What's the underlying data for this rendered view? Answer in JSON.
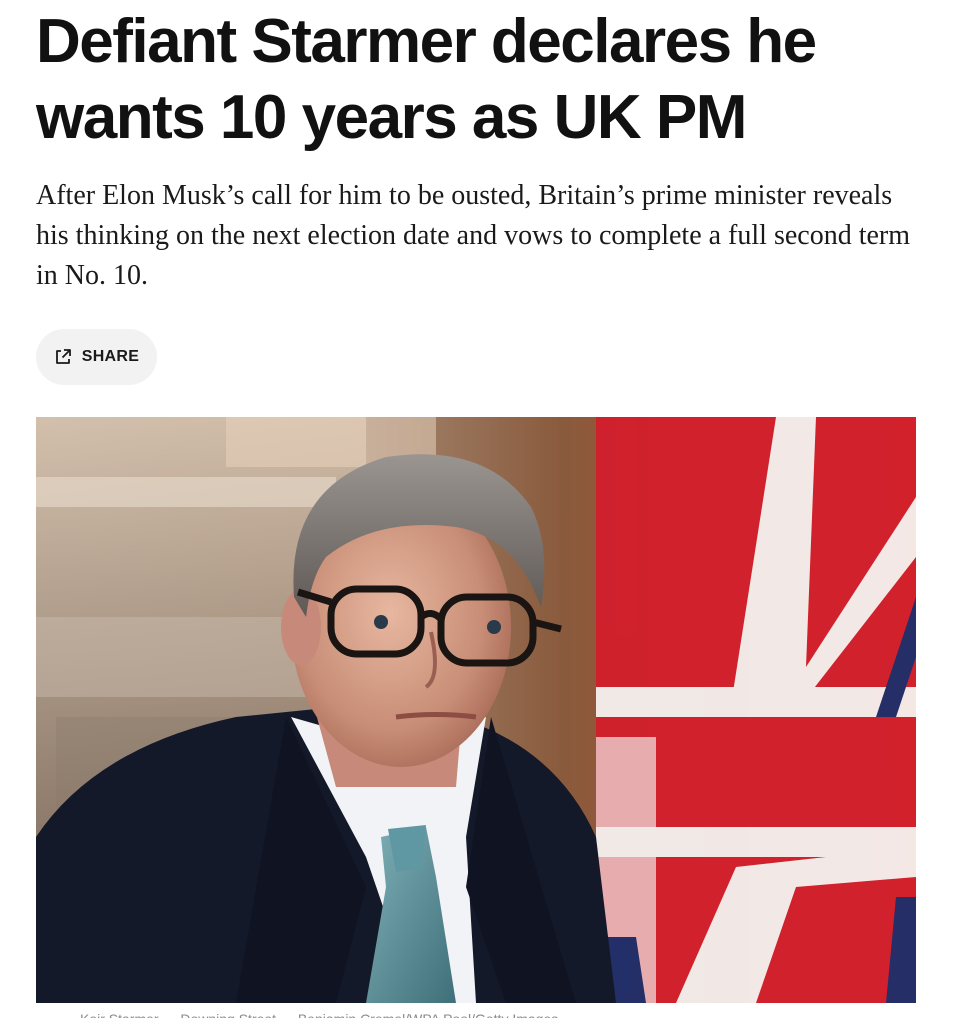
{
  "article": {
    "headline": "Defiant Starmer declares he wants 10 years as UK PM",
    "dek": "After Elon Musk’s call for him to be ousted, Britain’s prime minister reveals his thinking on the next election date and vows to complete a full second term in No. 10.",
    "share": {
      "label": "SHARE",
      "icon": "share-external-icon"
    },
    "hero_image": {
      "alt": "Keir Starmer in front of a Union flag"
    },
    "caption": "Keir Starmer … Downing Street … Benjamin Cremel/WPA Pool/Getty Images"
  },
  "colors": {
    "headline": "#111111",
    "dek": "#1a1a1a",
    "share_bg": "#f2f2f2",
    "caption": "#8a8a8a",
    "flag_red": "#d31f2c",
    "flag_white": "#f6f1ef",
    "flag_blue": "#1e2d6b"
  }
}
